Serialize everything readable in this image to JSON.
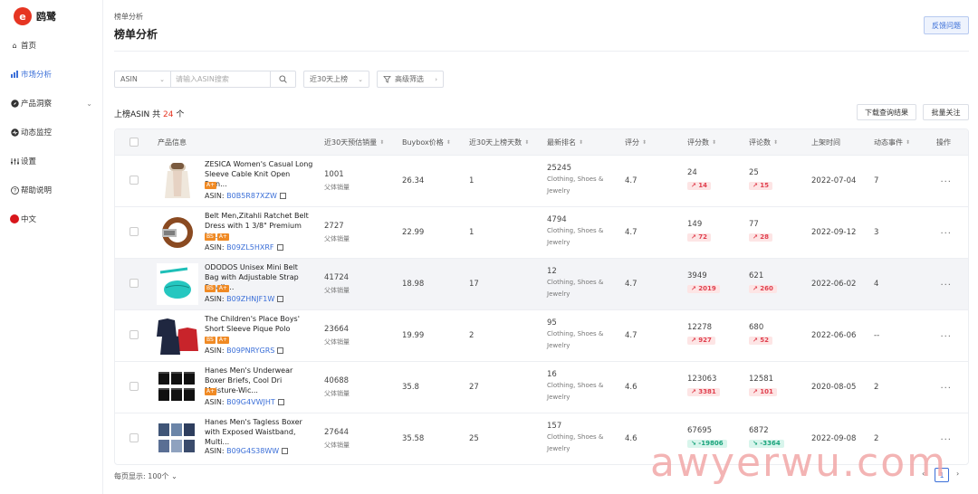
{
  "app": {
    "name": "鸥鹭",
    "logo_char": "e"
  },
  "sidebar": {
    "items": [
      {
        "label": "首页",
        "icon": "home-icon",
        "glyph": "⌂"
      },
      {
        "label": "市场分析",
        "icon": "bar-chart-icon",
        "glyph": "▮",
        "active": true
      },
      {
        "label": "产品洞察",
        "icon": "compass-icon",
        "glyph": "◉",
        "chevron": "⌄"
      },
      {
        "label": "动态监控",
        "icon": "monitor-icon",
        "glyph": "◉"
      },
      {
        "label": "设置",
        "icon": "settings-icon",
        "glyph": "⸽"
      },
      {
        "label": "帮助说明",
        "icon": "help-icon",
        "glyph": "?"
      },
      {
        "label": "中文",
        "icon": "china-flag-icon"
      }
    ]
  },
  "header": {
    "breadcrumb": "榜单分析",
    "title": "榜单分析",
    "feedback_button": "反馈问题"
  },
  "filters": {
    "field_select": "ASIN",
    "search_placeholder": "请输入ASIN搜索",
    "period_select": "近30天上榜",
    "advanced_filter": "高级筛选",
    "advanced_filter_arrow": "›"
  },
  "results": {
    "label": "上榜ASIN",
    "count_prefix": "共",
    "count": "24",
    "count_suffix": "个",
    "download_button": "下载查询结果",
    "bulk_follow_button": "批量关注"
  },
  "table": {
    "columns": [
      "产品信息",
      "近30天预估销量",
      "Buybox价格",
      "近30天上榜天数",
      "最新排名",
      "评分",
      "评分数",
      "评论数",
      "上架时间",
      "动态事件",
      "操作"
    ],
    "sort_glyph": "⬍",
    "sales_sub_label": "父体销量",
    "asin_prefix": "ASIN:",
    "more_glyph": "···",
    "rows": [
      {
        "name": "ZESICA Women's Casual Long Sleeve Cable Knit Open Fron...",
        "badges": [
          "A+"
        ],
        "asin": "B0B5R87XZW",
        "sales": "1001",
        "price": "26.34",
        "days": "1",
        "rank": "25245",
        "category": "Clothing, Shoes & Jewelry",
        "rating": "4.7",
        "ratings": "24",
        "ratings_delta": "↗ 14",
        "ratings_dir": "up",
        "reviews": "25",
        "reviews_delta": "↗ 15",
        "reviews_dir": "up",
        "date": "2022-07-04",
        "events": "7"
      },
      {
        "name": "Belt Men,Zitahli Ratchet Belt Dress with 1 3/8\" Premium Le...",
        "badges": [
          "BS",
          "A+"
        ],
        "asin": "B09ZL5HXRF",
        "sales": "2727",
        "price": "22.99",
        "days": "1",
        "rank": "4794",
        "category": "Clothing, Shoes & Jewelry",
        "rating": "4.7",
        "ratings": "149",
        "ratings_delta": "↗ 72",
        "ratings_dir": "up",
        "reviews": "77",
        "reviews_delta": "↗ 28",
        "reviews_dir": "up",
        "date": "2022-09-12",
        "events": "3"
      },
      {
        "name": "ODODOS Unisex Mini Belt Bag with Adjustable Strap Small ...",
        "badges": [
          "BS",
          "A+"
        ],
        "asin": "B09ZHNJF1W",
        "sales": "41724",
        "price": "18.98",
        "days": "17",
        "rank": "12",
        "category": "Clothing, Shoes & Jewelry",
        "rating": "4.7",
        "ratings": "3949",
        "ratings_delta": "↗ 2019",
        "ratings_dir": "up",
        "reviews": "621",
        "reviews_delta": "↗ 260",
        "reviews_dir": "up",
        "date": "2022-06-02",
        "events": "4"
      },
      {
        "name": "The Children's Place Boys' Short Sleeve Pique Polo",
        "badges": [
          "BS",
          "A+"
        ],
        "asin": "B09PNRYGRS",
        "sales": "23664",
        "price": "19.99",
        "days": "2",
        "rank": "95",
        "category": "Clothing, Shoes & Jewelry",
        "rating": "4.7",
        "ratings": "12278",
        "ratings_delta": "↗ 927",
        "ratings_dir": "up",
        "reviews": "680",
        "reviews_delta": "↗ 52",
        "reviews_dir": "up",
        "date": "2022-06-06",
        "events": "--"
      },
      {
        "name": "Hanes Men's Underwear Boxer Briefs, Cool Dri Moisture-Wic...",
        "badges": [
          "A+"
        ],
        "asin": "B09G4VWJHT",
        "sales": "40688",
        "price": "35.8",
        "days": "27",
        "rank": "16",
        "category": "Clothing, Shoes & Jewelry",
        "rating": "4.6",
        "ratings": "123063",
        "ratings_delta": "↗ 3381",
        "ratings_dir": "up",
        "reviews": "12581",
        "reviews_delta": "↗ 101",
        "reviews_dir": "up",
        "date": "2020-08-05",
        "events": "2"
      },
      {
        "name": "Hanes Men's Tagless Boxer with Exposed Waistband, Multi...",
        "badges": [],
        "asin": "B09G4S38WW",
        "sales": "27644",
        "price": "35.58",
        "days": "25",
        "rank": "157",
        "category": "Clothing, Shoes & Jewelry",
        "rating": "4.6",
        "ratings": "67695",
        "ratings_delta": "↘ -19806",
        "ratings_dir": "down",
        "reviews": "6872",
        "reviews_delta": "↘ -3364",
        "reviews_dir": "down",
        "date": "2022-09-08",
        "events": "2"
      }
    ]
  },
  "footer": {
    "page_size_label": "每页显示:",
    "page_size": "100个",
    "page_size_chev": "⌄",
    "prev_glyph": "‹",
    "next_glyph": "›",
    "current_page": "1"
  },
  "watermark": "awyerwu.com",
  "colors": {
    "accent": "#3b6fd8",
    "brand": "#e63522",
    "up": "#e0404f",
    "down": "#18a37a"
  }
}
